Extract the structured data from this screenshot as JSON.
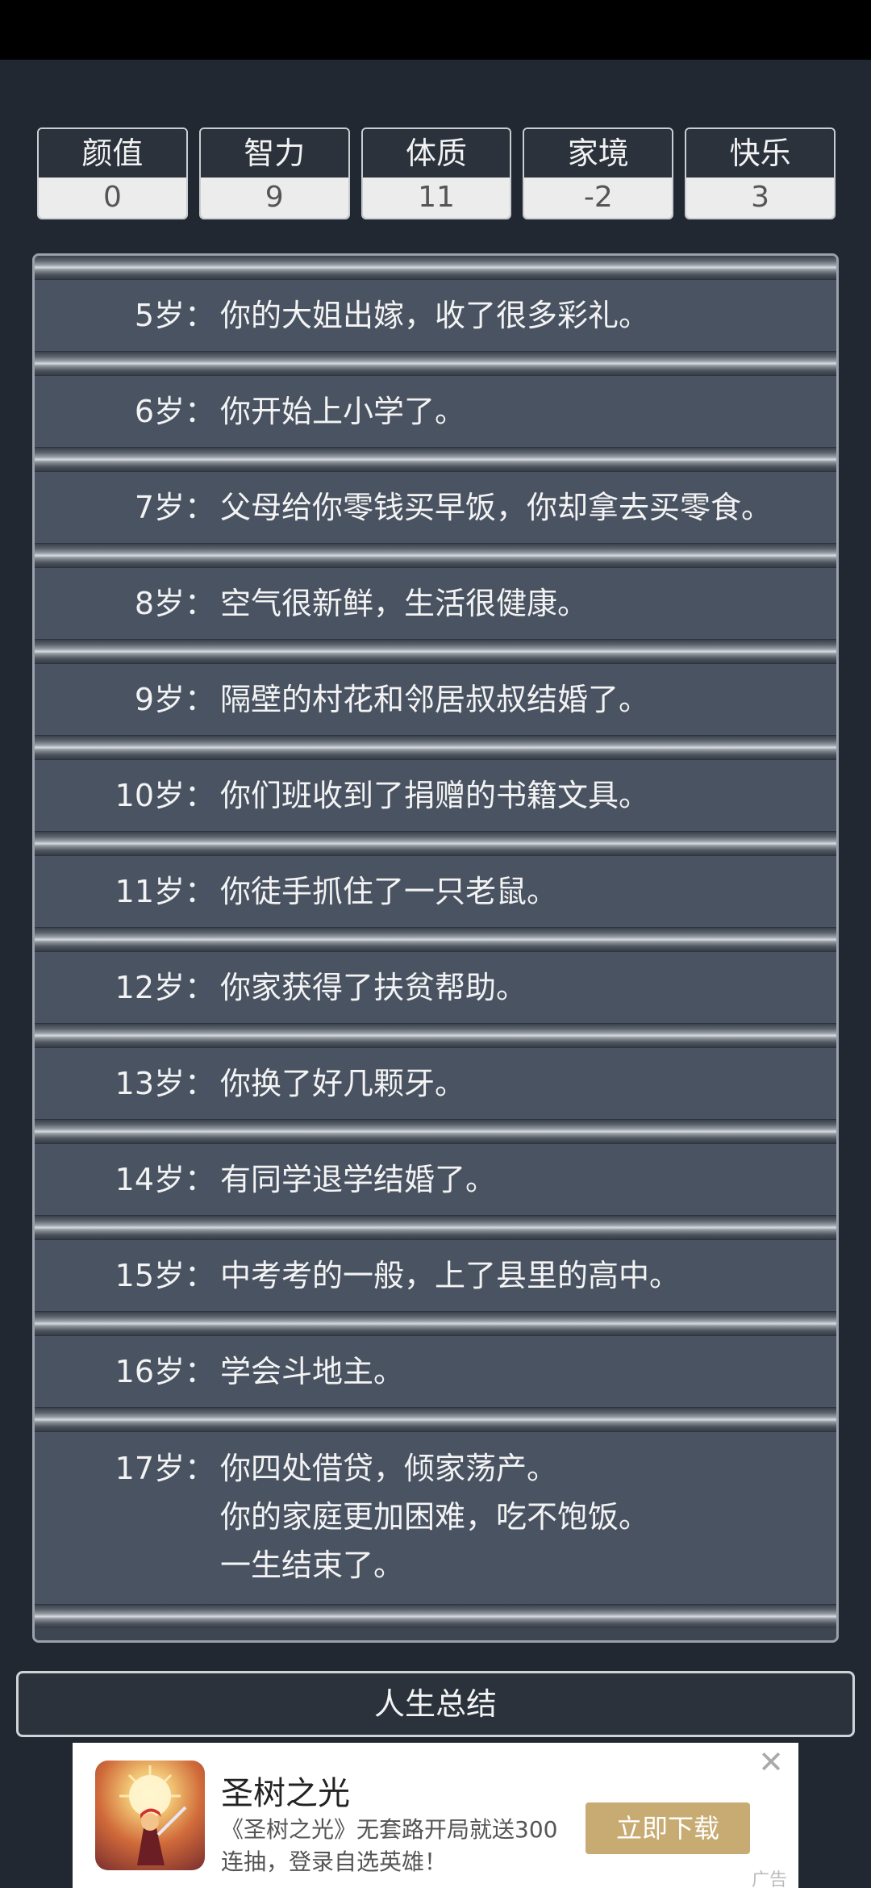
{
  "stats": [
    {
      "label": "颜值",
      "value": "0"
    },
    {
      "label": "智力",
      "value": "9"
    },
    {
      "label": "体质",
      "value": "11"
    },
    {
      "label": "家境",
      "value": "-2"
    },
    {
      "label": "快乐",
      "value": "3"
    }
  ],
  "events": [
    {
      "age": "5岁：",
      "lines": [
        "你的大姐出嫁，收了很多彩礼。"
      ]
    },
    {
      "age": "6岁：",
      "lines": [
        "你开始上小学了。"
      ]
    },
    {
      "age": "7岁：",
      "lines": [
        "父母给你零钱买早饭，你却拿去买零食。"
      ]
    },
    {
      "age": "8岁：",
      "lines": [
        "空气很新鲜，生活很健康。"
      ]
    },
    {
      "age": "9岁：",
      "lines": [
        "隔壁的村花和邻居叔叔结婚了。"
      ]
    },
    {
      "age": "10岁：",
      "lines": [
        "你们班收到了捐赠的书籍文具。"
      ]
    },
    {
      "age": "11岁：",
      "lines": [
        "你徒手抓住了一只老鼠。"
      ]
    },
    {
      "age": "12岁：",
      "lines": [
        "你家获得了扶贫帮助。"
      ]
    },
    {
      "age": "13岁：",
      "lines": [
        "你换了好几颗牙。"
      ]
    },
    {
      "age": "14岁：",
      "lines": [
        "有同学退学结婚了。"
      ]
    },
    {
      "age": "15岁：",
      "lines": [
        "中考考的一般，上了县里的高中。"
      ]
    },
    {
      "age": "16岁：",
      "lines": [
        "学会斗地主。"
      ]
    },
    {
      "age": "17岁：",
      "lines": [
        "你四处借贷，倾家荡产。",
        "你的家庭更加困难，吃不饱饭。",
        "一生结束了。"
      ]
    }
  ],
  "summary_button": "人生总结",
  "ad": {
    "title": "圣树之光",
    "description": "《圣树之光》无套路开局就送300连抽，登录自选英雄！",
    "cta": "立即下载",
    "close_icon": "close-icon",
    "badge": "广告"
  }
}
